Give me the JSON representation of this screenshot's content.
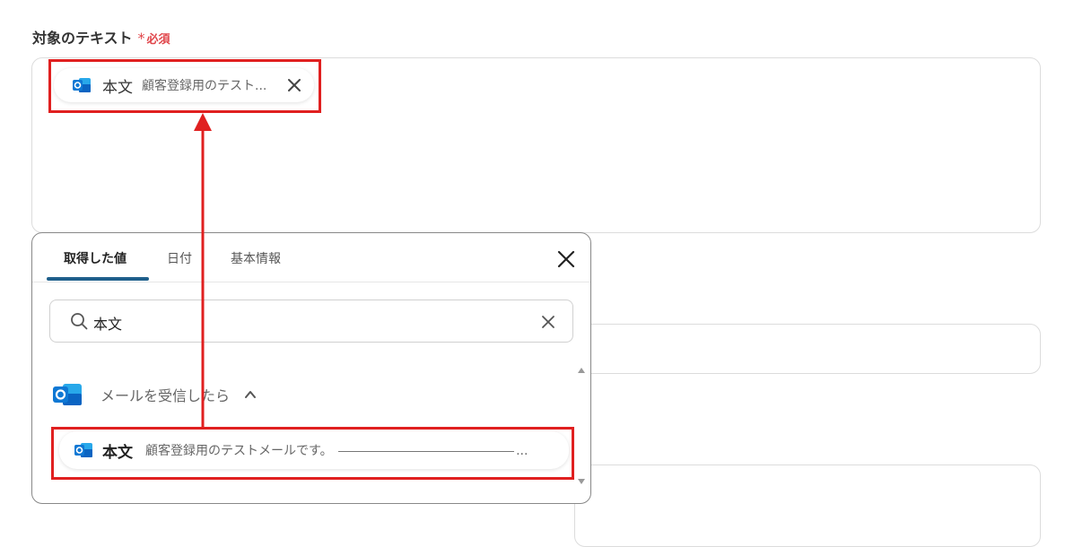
{
  "field": {
    "label": "対象のテキスト",
    "required_mark": "*",
    "required_text": "必須"
  },
  "selected_chip": {
    "icon": "outlook-icon",
    "label": "本文",
    "value": "顧客登録用のテスト..."
  },
  "panel": {
    "tabs": [
      {
        "label": "取得した値",
        "active": true
      },
      {
        "label": "日付",
        "active": false
      },
      {
        "label": "基本情報",
        "active": false
      }
    ],
    "search": {
      "value": "本文"
    },
    "group": {
      "label": "メールを受信したら",
      "icon": "outlook-icon"
    },
    "result": {
      "label": "本文",
      "value": "顧客登録用のテストメールです。",
      "ellipsis": "..."
    }
  },
  "colors": {
    "accent": "#1f5f8b",
    "required": "#e0454a",
    "highlight": "#e02020"
  }
}
